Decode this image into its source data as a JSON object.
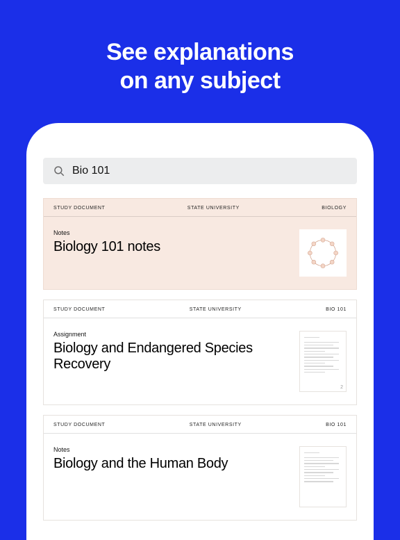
{
  "headline_line1": "See explanations",
  "headline_line2": "on any subject",
  "search": {
    "value": "Bio 101"
  },
  "cards": [
    {
      "header_left": "STUDY DOCUMENT",
      "header_center": "STATE UNIVERSITY",
      "header_right": "BIOLOGY",
      "kind": "Notes",
      "title": "Biology 101 notes"
    },
    {
      "header_left": "STUDY DOCUMENT",
      "header_center": "STATE UNIVERSITY",
      "header_right": "BIO 101",
      "kind": "Assignment",
      "title": "Biology and Endangered Species Recovery",
      "page_count": "2"
    },
    {
      "header_left": "STUDY DOCUMENT",
      "header_center": "STATE UNIVERSITY",
      "header_right": "BIO 101",
      "kind": "Notes",
      "title": "Biology and the Human Body"
    }
  ]
}
